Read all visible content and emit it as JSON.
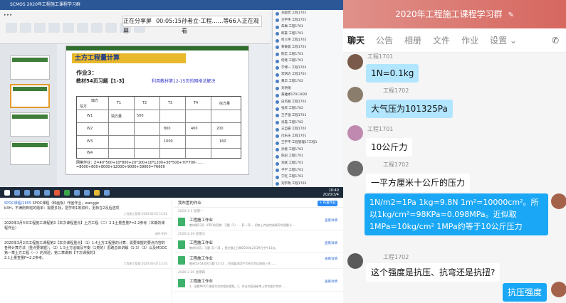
{
  "share": {
    "title": "SCMOS    2020年工程施工课程学习群",
    "banner_status": "正在分享屏幕",
    "banner_time": "00:05:15",
    "banner_viewers": "孙者立·工程……等66人正在观看",
    "slide": {
      "title": "土方工程量计算",
      "heading": "作业3：",
      "subheading": "教材54页习题【1-3】",
      "note": "利用教材第12-15页的网格法解决",
      "table_cells": [
        "填方",
        "挖方",
        "T1",
        "T2",
        "T3",
        "T4",
        "挖方量",
        "W1",
        "W2",
        "W3",
        "W4",
        "填方量",
        "500",
        "800",
        "400",
        "200",
        "1000",
        "160"
      ],
      "footer": "网格作业：Z=40*500+10*800+20*100+10*1200+30*500+70*700-……=8000+800+8000+12000+9000+39000=76600"
    },
    "participants": [
      "刘超曾 工程1701",
      "王宇伟 工程1701",
      "朱琳 工程1701",
      "邱豪 工程1701",
      "何义伟 工程1702",
      "黎豪晨 工程1701",
      "陈宏 工程1701",
      "何继 工程1701",
      "学博一 工程1702",
      "李炳达 工程1701",
      "黄华 工程1702",
      "刘洪翔",
      "黄雅婷17013020",
      "白杰朋 工程1702",
      "张欣 工程1702",
      "王子强 工程1701",
      "肖磊 工程1702",
      "王自豪 工程1702",
      "闫乐乐 工程1701",
      "王宇平·工程管理17工程1",
      "孙者 工程1701",
      "陈纪 工程1701",
      "刘斌 工程1701",
      "子学 工程1701",
      "宁吃 工程1701",
      "刘宇政 工程1702",
      "刘宇林17013010",
      "刘燕 工程1702",
      "许思 工程1702",
      "孙字学 工程1702"
    ],
    "clock_time": "10:40",
    "clock_date": "2020/3/4"
  },
  "forum": {
    "posts": [
      {
        "tag": "SPOC课程/1605",
        "text": "SPOC课程（和画板）作画作业，wangge",
        "detail": "b3H，不满刚到班的题单：需要多找，把学到1等资料，更新在2及后选项",
        "meta": "工程施工管理  2020-03-02 14:30"
      },
      {
        "tag": "",
        "text": "2020年3月4日工程施工课程第3【本次课程重点】土方工程（二）2.1土量查量P=2.2参考（本期的课程作业）",
        "detail": "",
        "meta": "课件  附件"
      },
      {
        "tag": "",
        "text": "2020年3月2日工程施工课程第2【本次课程重点】（1）1.4土方工程量的计算：需要掌握的要点内容的各种计算方法（重点要掌握）；（2）1.5土方运输及平衡（1类的）思路总体讲解（1-3）（3）以及MOOC第一章土方工程（一）的测验，第二章做到【下次课我的】",
        "detail": "2.1土量查量P=2.2参考。",
        "meta": "工程施工管理  2020-03-02 13:20"
      }
    ]
  },
  "homework": {
    "header": "我布置的作业",
    "button": "+ 布置作业",
    "groups": [
      {
        "date": "2020-3-3 星期一",
        "items": [
          {
            "name": "工程施工作业",
            "desc": "教材第23页（PDF的页数）习题（1）、【1~3】，用来上传或完成填写的答题卡 ...",
            "action": "查看详情"
          }
        ]
      },
      {
        "date": "2020-2-26 星期三",
        "items": [
          {
            "name": "工程施工作业",
            "desc": "教材54页，习题【1~3】，提交截止日期2020年2月29日中午10点。",
            "action": "查看详情"
          },
          {
            "name": "工程施工作业",
            "desc": "教材53-54页的习题【1-1】，完成要求用手写纸写完后拍照上传……",
            "action": "查看详情"
          }
        ]
      },
      {
        "date": "2020-2-20 星期四",
        "items": [
          {
            "name": "工程施工作业",
            "desc": "1、请看MOOC课程本次的相关视频。2、作业内容请参考上传的图片附件……",
            "action": "查看详情"
          }
        ]
      }
    ]
  },
  "chat": {
    "title": "2020年工程施工课程学习群",
    "tabs": [
      "聊天",
      "公告",
      "相册",
      "文件",
      "作业",
      "设置"
    ],
    "messages": [
      {
        "sender": "工程1701",
        "text": "1N=0.1kg",
        "style": "blue"
      },
      {
        "sender": "工程1702",
        "text": "大气压为101325Pa",
        "style": "blue"
      },
      {
        "sender": "工程1701",
        "text": "10公斤力",
        "style": "in"
      },
      {
        "sender": "工程1702",
        "text": "一平方厘米十公斤的压力",
        "style": "in"
      },
      {
        "sender": "",
        "text": "1N/m2=1Pa 1kg=9.8N 1m²=10000cm²。所以1kg/cm²=98KPa=0.098MPa。近似取1MPa=10kg/cm²  1MPa约等于10公斤压力",
        "style": "out"
      },
      {
        "sender": "工程1702",
        "text": "这个强度是抗压、抗弯还是抗扭?",
        "style": "in"
      },
      {
        "sender": "",
        "text": "抗压强度",
        "style": "out"
      }
    ]
  },
  "colors": {
    "chat_title_bg": "#d6675f",
    "outgoing_bubble": "#1aa7f5",
    "incoming_bubble": "#ffffff",
    "highlight_bubble": "#b2e6ff"
  }
}
